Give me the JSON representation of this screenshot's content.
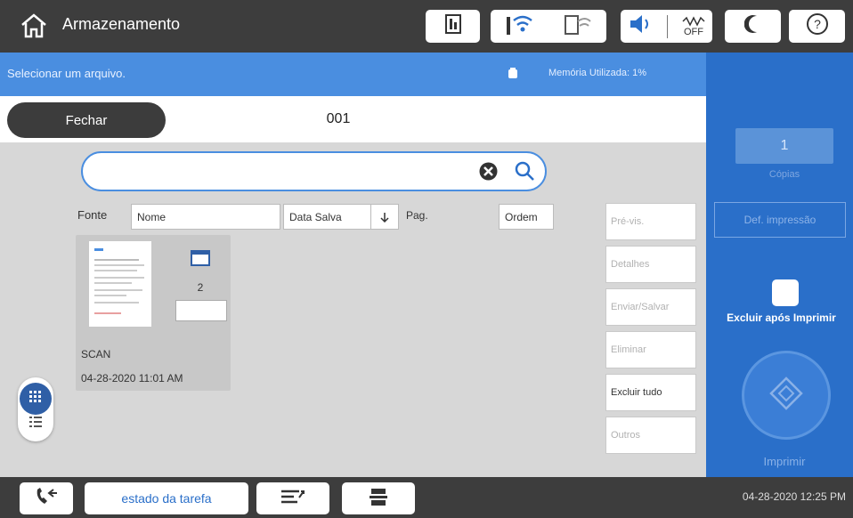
{
  "topbar": {
    "title": "Armazenamento",
    "icons": [
      "home-icon",
      "ink-icon",
      "wifi-icon",
      "wifi-direct-icon",
      "sound-icon",
      "quiet-off-icon",
      "sleep-icon",
      "help-icon"
    ],
    "quiet_off_label": "OFF"
  },
  "banner": {
    "instruction": "Selecionar um arquivo.",
    "memory": "Memória Utilizada: 1%"
  },
  "header": {
    "close_label": "Fechar",
    "folder_number": "001"
  },
  "search": {
    "value": "",
    "placeholder": ""
  },
  "sort": {
    "fonte_label": "Fonte",
    "name_label": "Nome",
    "date_label": "Data Salva",
    "pages_label": "Pag.",
    "order_label": "Ordem"
  },
  "file": {
    "count": "2",
    "name": "SCAN",
    "date": "04-28-2020 11:01 AM"
  },
  "actions": [
    {
      "label": "Pré-vis.",
      "enabled": false
    },
    {
      "label": "Detalhes",
      "enabled": false
    },
    {
      "label": "Enviar/Salvar",
      "enabled": false
    },
    {
      "label": "Eliminar",
      "enabled": false
    },
    {
      "label": "Excluir tudo",
      "enabled": true
    },
    {
      "label": "Outros",
      "enabled": false
    }
  ],
  "right_panel": {
    "copies_value": "1",
    "copies_label": "Cópias",
    "settings_label": "Def. impressão",
    "delete_after_label": "Excluir após Imprimir",
    "print_label": "Imprimir"
  },
  "bottombar": {
    "status_label": "estado da tarefa",
    "datetime": "04-28-2020 12:25 PM"
  },
  "colors": {
    "accent": "#2a6fc9",
    "banner": "#4a8ee0",
    "bar": "#3d3d3d"
  }
}
